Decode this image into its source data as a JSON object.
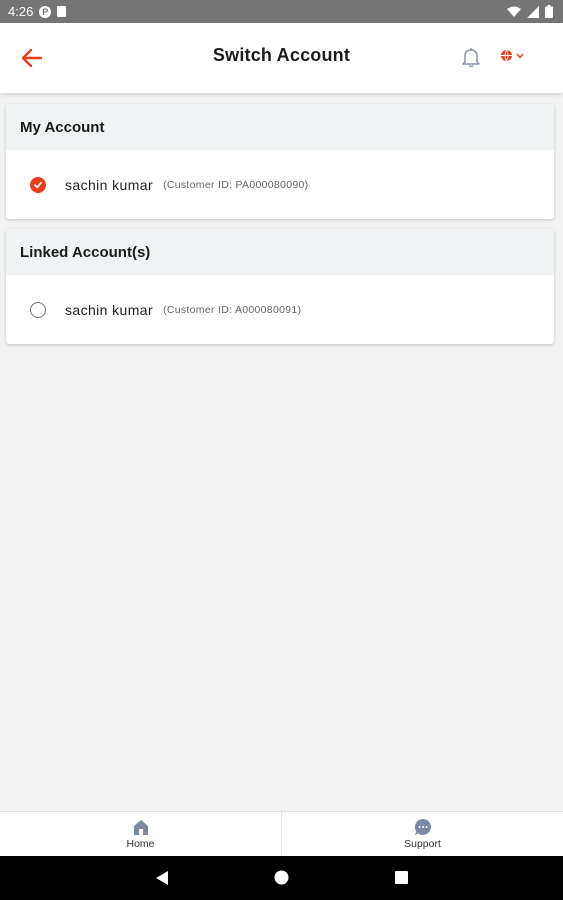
{
  "status_bar": {
    "time": "4:26",
    "icons": [
      "app-notification-icon",
      "sd-card-icon",
      "wifi-icon",
      "signal-icon",
      "battery-icon"
    ]
  },
  "header": {
    "title": "Switch Account",
    "back_icon": "arrow-left-icon",
    "bell_icon": "bell-icon",
    "language_icon": "globe-icon"
  },
  "my_account": {
    "heading": "My Account",
    "accounts": [
      {
        "name": "sachin kumar",
        "customer_id": "(Customer ID: PA000080090)",
        "selected": true
      }
    ]
  },
  "linked_accounts": {
    "heading": "Linked Account(s)",
    "accounts": [
      {
        "name": "sachin kumar",
        "customer_id": "(Customer ID: A000080091)",
        "selected": false
      }
    ]
  },
  "bottom_nav": {
    "items": [
      {
        "label": "Home",
        "icon": "home-icon"
      },
      {
        "label": "Support",
        "icon": "chat-icon"
      }
    ]
  },
  "colors": {
    "accent": "#e8401e",
    "header_bg": "#ffffff",
    "section_bg": "#eff3f4",
    "page_bg": "#f2f2f2",
    "nav_icon": "#7b89a3"
  }
}
